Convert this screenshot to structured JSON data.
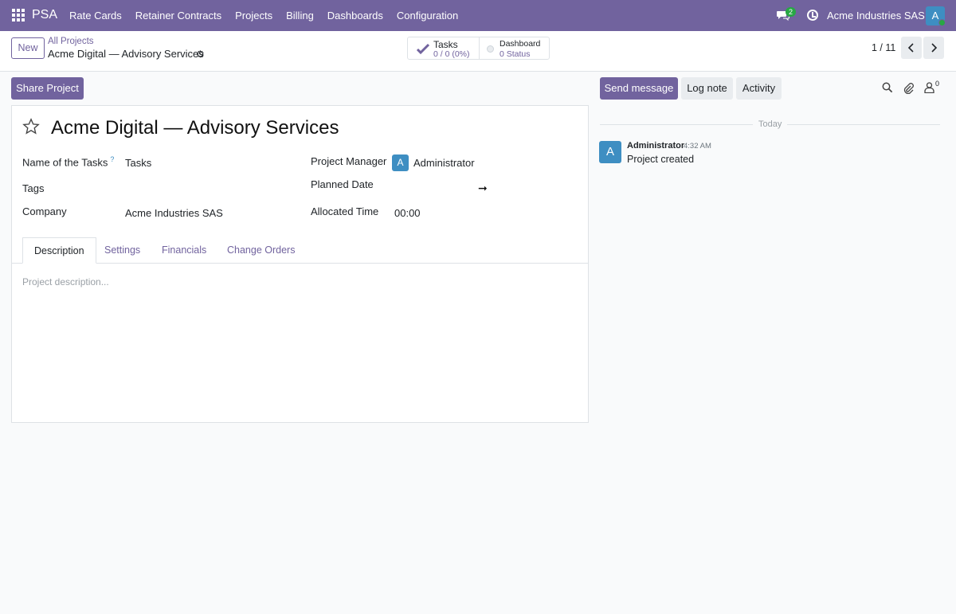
{
  "navbar": {
    "app_name": "PSA",
    "menu": [
      "Rate Cards",
      "Retainer Contracts",
      "Projects",
      "Billing",
      "Dashboards",
      "Configuration"
    ],
    "chat_badge": "2",
    "company": "Acme Industries SAS",
    "avatar_letter": "A"
  },
  "control": {
    "new_label": "New",
    "breadcrumb_parent": "All Projects",
    "breadcrumb_current": "Acme Digital — Advisory Services",
    "stat_tasks_label": "Tasks",
    "stat_tasks_value": "0 / 0 (0%)",
    "stat_dashboard_label": "Dashboard",
    "stat_dashboard_value": "0 Status",
    "pager": "1 / 11"
  },
  "actions": {
    "share_label": "Share Project"
  },
  "form": {
    "title": "Acme Digital — Advisory Services",
    "fields": {
      "task_name_label": "Name of the Tasks",
      "task_name_help": "?",
      "task_name_value": "Tasks",
      "tags_label": "Tags",
      "company_label": "Company",
      "company_value": "Acme Industries SAS",
      "manager_label": "Project Manager",
      "manager_avatar": "A",
      "manager_value": "Administrator",
      "planned_date_label": "Planned Date",
      "allocated_time_label": "Allocated Time",
      "allocated_time_value": "00:00"
    },
    "tabs": [
      "Description",
      "Settings",
      "Financials",
      "Change Orders"
    ],
    "active_tab": "Description",
    "description_placeholder": "Project description..."
  },
  "chatter": {
    "send_label": "Send message",
    "log_label": "Log note",
    "activity_label": "Activity",
    "followers_count": "0",
    "date_separator": "Today",
    "messages": [
      {
        "avatar": "A",
        "author": "Administrator",
        "time": "4:32 AM",
        "body": "Project created"
      }
    ]
  },
  "colors": {
    "brand": "#71639e",
    "avatar": "#3e8ec2",
    "badge": "#28a745"
  }
}
